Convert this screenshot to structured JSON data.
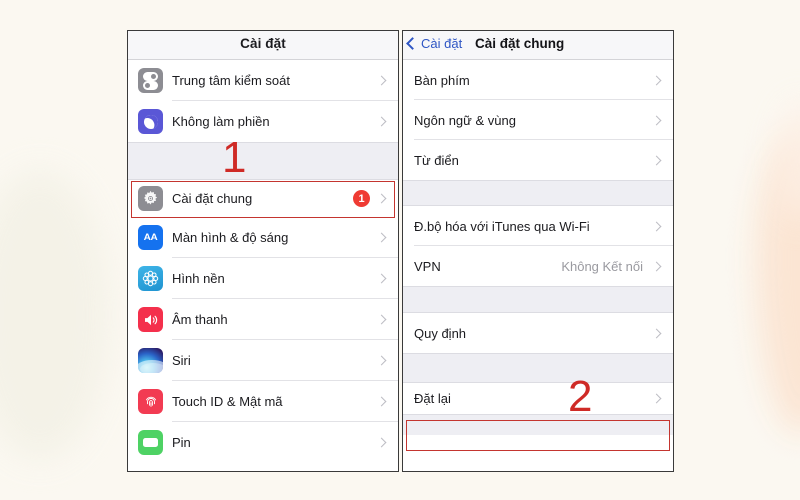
{
  "background": {
    "color": "#fbf8f1",
    "blob_right_color": "#fbe4d2",
    "blob_left_color": "#f3f1e6"
  },
  "accent": {
    "ios_blue": "#2f56c4",
    "badge_red": "#ef3b33",
    "annotation_red": "#cf2a26"
  },
  "left_panel": {
    "nav": {
      "title": "Cài đặt"
    },
    "items": [
      {
        "label": "Trung tâm kiểm soát",
        "icon": "control-center-icon",
        "chevron": true,
        "badge": null,
        "value": null
      },
      {
        "label": "Không làm phiền",
        "icon": "do-not-disturb-moon-icon",
        "chevron": true,
        "badge": null,
        "value": null
      },
      {
        "label": "Cài đặt chung",
        "icon": "gear-icon",
        "chevron": true,
        "badge": "1",
        "value": null,
        "highlighted": true
      },
      {
        "label": "Màn hình & độ sáng",
        "icon": "display-brightness-aa-icon",
        "chevron": true,
        "badge": null,
        "value": null
      },
      {
        "label": "Hình nền",
        "icon": "wallpaper-flower-icon",
        "chevron": true,
        "badge": null,
        "value": null
      },
      {
        "label": "Âm thanh",
        "icon": "sound-speaker-icon",
        "chevron": true,
        "badge": null,
        "value": null
      },
      {
        "label": "Siri",
        "icon": "siri-orb-icon",
        "chevron": true,
        "badge": null,
        "value": null
      },
      {
        "label": "Touch ID & Mật mã",
        "icon": "touch-id-fingerprint-icon",
        "chevron": true,
        "badge": null,
        "value": null
      },
      {
        "label": "Pin",
        "icon": "battery-icon",
        "chevron": true,
        "badge": null,
        "value": null
      }
    ]
  },
  "right_panel": {
    "nav": {
      "back_label": "Cài đặt",
      "title": "Cài đặt chung"
    },
    "items": [
      {
        "label": "Bàn phím",
        "chevron": true,
        "value": null
      },
      {
        "label": "Ngôn ngữ & vùng",
        "chevron": true,
        "value": null
      },
      {
        "label": "Từ điển",
        "chevron": true,
        "value": null
      },
      {
        "label": "Đ.bộ hóa với iTunes qua Wi-Fi",
        "chevron": true,
        "value": null
      },
      {
        "label": "VPN",
        "chevron": true,
        "value": "Không Kết nối"
      },
      {
        "label": "Quy định",
        "chevron": true,
        "value": null
      },
      {
        "label": "Đặt lại",
        "chevron": true,
        "value": null,
        "highlighted": true
      }
    ]
  },
  "annotations": [
    {
      "id": "step-1",
      "text": "1",
      "target": "Cài đặt chung"
    },
    {
      "id": "step-2",
      "text": "2",
      "target": "Đặt lại"
    }
  ]
}
